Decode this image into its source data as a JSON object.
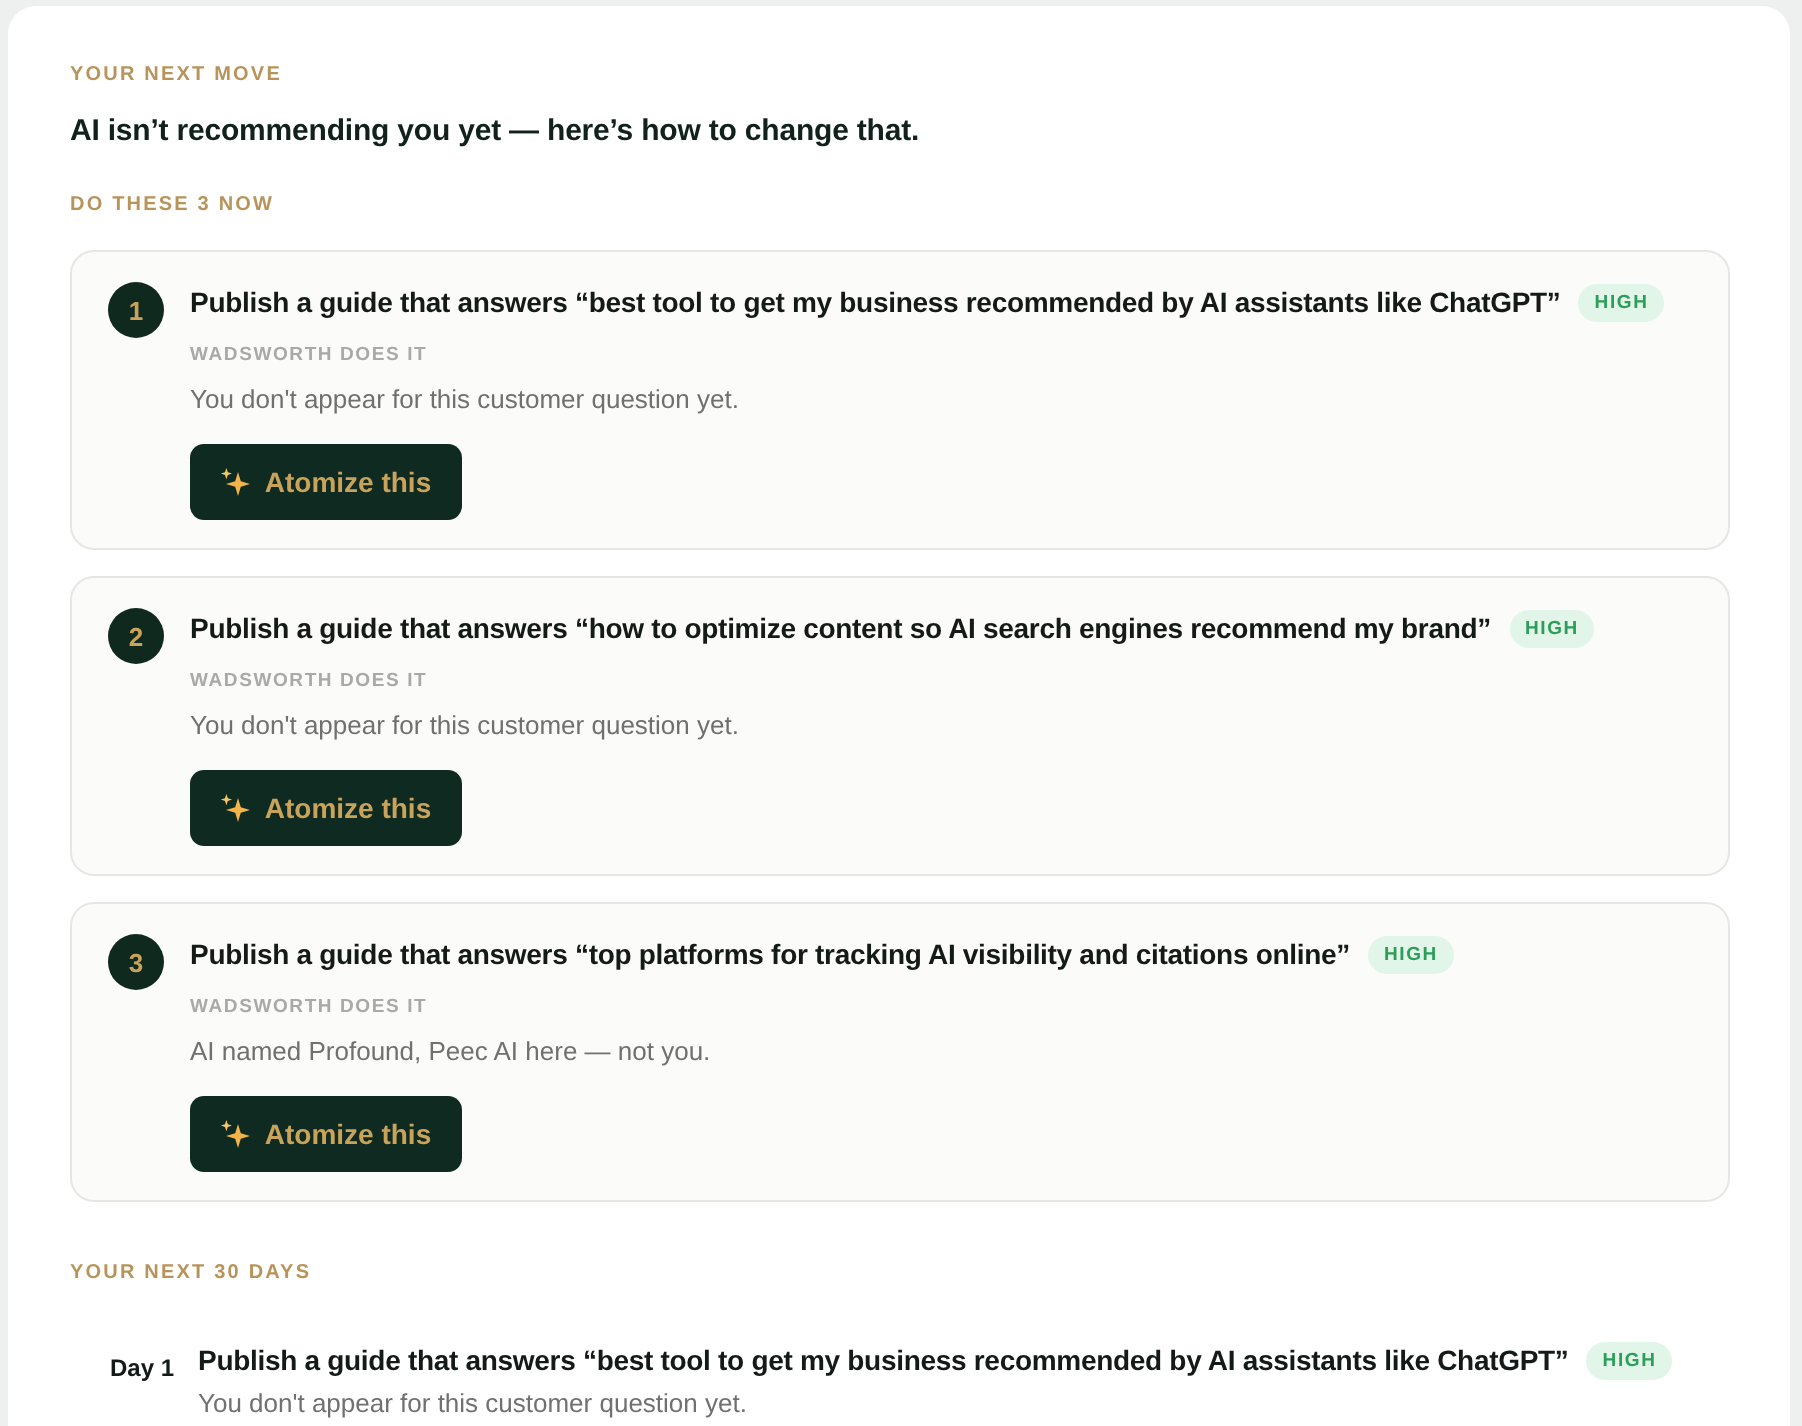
{
  "next_move": {
    "eyebrow": "YOUR NEXT MOVE",
    "headline": "AI isn’t recommending you yet — here’s how to change that."
  },
  "now": {
    "heading": "DO THESE 3 NOW",
    "actions": [
      {
        "number": "1",
        "title": "Publish a guide that answers “best tool to get my business recommended by AI assistants like ChatGPT”",
        "priority": "HIGH",
        "owner": "WADSWORTH DOES IT",
        "note": "You don't appear for this customer question yet.",
        "button": "Atomize this"
      },
      {
        "number": "2",
        "title": "Publish a guide that answers “how to optimize content so AI search engines recommend my brand”",
        "priority": "HIGH",
        "owner": "WADSWORTH DOES IT",
        "note": "You don't appear for this customer question yet.",
        "button": "Atomize this"
      },
      {
        "number": "3",
        "title": "Publish a guide that answers “top platforms for tracking AI visibility and citations online”",
        "priority": "HIGH",
        "owner": "WADSWORTH DOES IT",
        "note": "AI named Profound, Peec AI here — not you.",
        "button": "Atomize this"
      }
    ]
  },
  "plan": {
    "heading": "YOUR NEXT 30 DAYS",
    "days": [
      {
        "day": "Day 1",
        "title": "Publish a guide that answers “best tool to get my business recommended by AI assistants like ChatGPT”",
        "priority": "HIGH",
        "note": "You don't appear for this customer question yet."
      }
    ]
  }
}
